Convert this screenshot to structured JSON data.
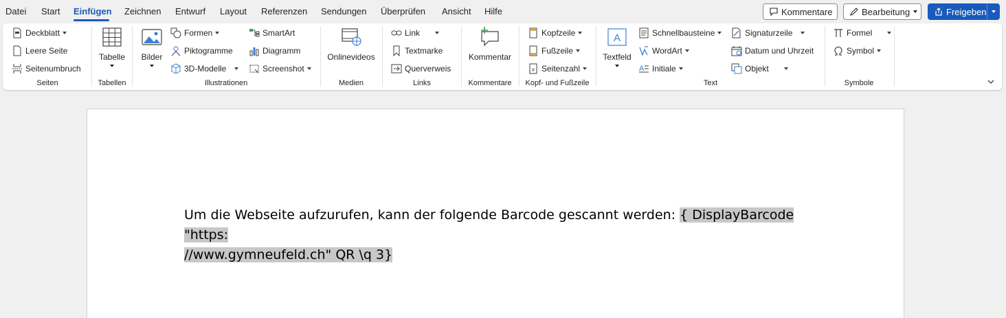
{
  "menu": {
    "items": [
      "Datei",
      "Start",
      "Einfügen",
      "Zeichnen",
      "Entwurf",
      "Layout",
      "Referenzen",
      "Sendungen",
      "Überprüfen",
      "Ansicht",
      "Hilfe"
    ],
    "active": "Einfügen"
  },
  "topbar": {
    "comments_label": "Kommentare",
    "editing_label": "Bearbeitung",
    "share_label": "Freigeben"
  },
  "ribbon": {
    "seiten": {
      "label": "Seiten",
      "deckblatt": "Deckblatt",
      "leere_seite": "Leere Seite",
      "seitenumbruch": "Seitenumbruch"
    },
    "tabellen": {
      "label": "Tabellen",
      "tabelle": "Tabelle"
    },
    "illustrationen": {
      "label": "Illustrationen",
      "bilder": "Bilder",
      "formen": "Formen",
      "piktogramme": "Piktogramme",
      "modelle3d": "3D-Modelle",
      "smartart": "SmartArt",
      "diagramm": "Diagramm",
      "screenshot": "Screenshot"
    },
    "medien": {
      "label": "Medien",
      "onlinevideos": "Onlinevideos"
    },
    "links": {
      "label": "Links",
      "link": "Link",
      "textmarke": "Textmarke",
      "querverweis": "Querverweis"
    },
    "kommentare": {
      "label": "Kommentare",
      "kommentar": "Kommentar"
    },
    "kopffuss": {
      "label": "Kopf- und Fußzeile",
      "kopfzeile": "Kopfzeile",
      "fusszeile": "Fußzeile",
      "seitenzahl": "Seitenzahl"
    },
    "text": {
      "label": "Text",
      "textfeld": "Textfeld",
      "schnellbausteine": "Schnellbausteine",
      "wordart": "WordArt",
      "initiale": "Initiale",
      "signaturzeile": "Signaturzeile",
      "datum_uhrzeit": "Datum und Uhrzeit",
      "objekt": "Objekt"
    },
    "symbole": {
      "label": "Symbole",
      "formel": "Formel",
      "symbol": "Symbol"
    }
  },
  "document": {
    "line1_text": "Um die Webseite aufzurufen, kann der folgende Barcode gescannt werden: ",
    "line1_field": "{ DisplayBarcode \"https:",
    "line2_field": "//www.gymneufeld.ch\" QR \\q 3}"
  },
  "colors": {
    "accent": "#185abd",
    "field_highlight": "#c8c8c8",
    "background": "#f0f0f0"
  }
}
